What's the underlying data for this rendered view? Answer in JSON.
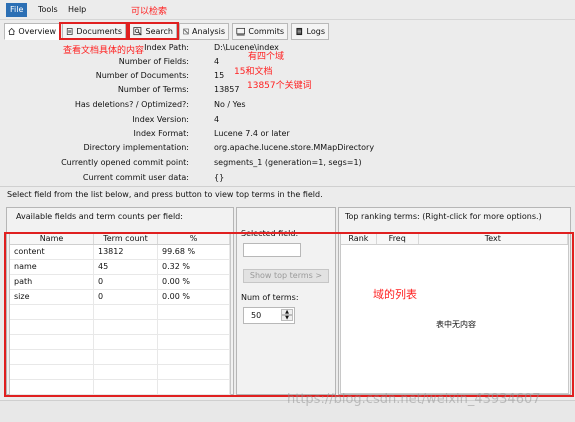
{
  "menubar": {
    "items": [
      "File",
      "Tools",
      "Help"
    ]
  },
  "tabs": [
    {
      "label": "Overview",
      "icon": "home-icon"
    },
    {
      "label": "Documents",
      "icon": "document-icon"
    },
    {
      "label": "Search",
      "icon": "search-icon"
    },
    {
      "label": "Analysis",
      "icon": "analysis-icon"
    },
    {
      "label": "Commits",
      "icon": "commits-icon"
    },
    {
      "label": "Logs",
      "icon": "logs-icon"
    }
  ],
  "overview": {
    "rows": [
      {
        "label": "Index Path:",
        "value": "D:\\Lucene\\index"
      },
      {
        "label": "Number of Fields:",
        "value": "4"
      },
      {
        "label": "Number of Documents:",
        "value": "15"
      },
      {
        "label": "Number of Terms:",
        "value": "13857"
      },
      {
        "label": "Has deletions? / Optimized?:",
        "value": "No / Yes"
      },
      {
        "label": "Index Version:",
        "value": "4"
      },
      {
        "label": "Index Format:",
        "value": "Lucene 7.4 or later"
      },
      {
        "label": "Directory implementation:",
        "value": "org.apache.lucene.store.MMapDirectory"
      },
      {
        "label": "Currently opened commit point:",
        "value": "segments_1 (generation=1, segs=1)"
      },
      {
        "label": "Current commit user data:",
        "value": "{}"
      }
    ],
    "help": "Select field from the list below, and press button to view top terms in the field."
  },
  "fields_panel": {
    "title": "Available fields and term counts per field:",
    "columns": [
      "Name",
      "Term count",
      "%"
    ],
    "rows": [
      [
        "content",
        "13812",
        "99.68 %"
      ],
      [
        "name",
        "45",
        "0.32 %"
      ],
      [
        "path",
        "0",
        "0.00 %"
      ],
      [
        "size",
        "0",
        "0.00 %"
      ]
    ]
  },
  "controls": {
    "selected_field_label": "Selected field:",
    "selected_field_value": "",
    "show_top_terms": "Show top terms >",
    "num_terms_label": "Num of terms:",
    "num_terms_value": "50"
  },
  "top_terms": {
    "title": "Top ranking terms: (Right-click for more options.)",
    "columns": [
      "Rank",
      "Freq",
      "Text"
    ],
    "empty_message": "表中无内容"
  },
  "annotations": {
    "search": "可以检索",
    "documents": "查看文档具体的内容",
    "fields": "有四个域",
    "docs": "15和文档",
    "terms": "13857个关键词",
    "field_list": "域的列表"
  },
  "watermark": "https://blog.csdn.net/weixin_43934607",
  "colors": {
    "annotation": "#e02020",
    "menu_active": "#2c6fb4"
  }
}
